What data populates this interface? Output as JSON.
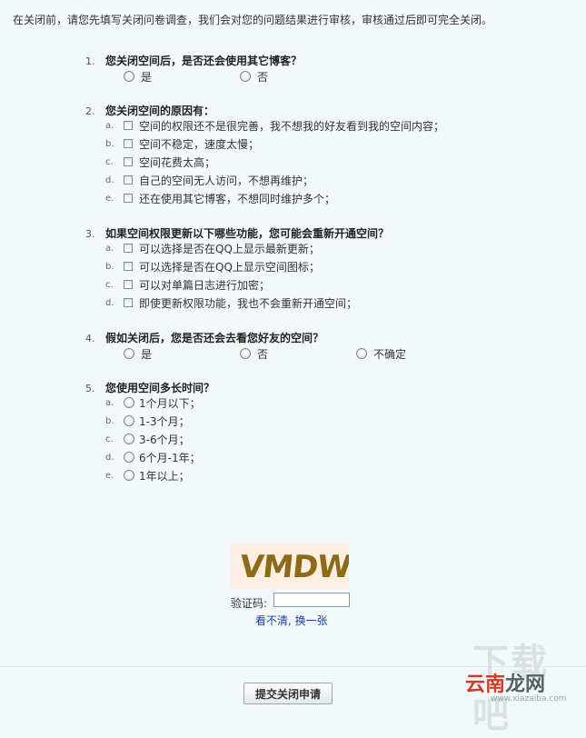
{
  "intro": "在关闭前，请您先填写关闭问卷调查，我们会对您的问题结果进行审核，审核通过后即可完全关闭。",
  "questions": [
    {
      "num": "1.",
      "title": "您关闭空间后，是否还会使用其它博客？",
      "options": [
        "是",
        "否"
      ]
    },
    {
      "num": "2.",
      "title": "您关闭空间的原因有：",
      "options": [
        {
          "letter": "a.",
          "text": "空间的权限还不是很完善，我不想我的好友看到我的空间内容；"
        },
        {
          "letter": "b.",
          "text": "空间不稳定，速度太慢；"
        },
        {
          "letter": "c.",
          "text": "空间花费太高；"
        },
        {
          "letter": "d.",
          "text": "自己的空间无人访问，不想再维护；"
        },
        {
          "letter": "e.",
          "text": "还在使用其它博客，不想同时维护多个；"
        }
      ]
    },
    {
      "num": "3.",
      "title": "如果空间权限更新以下哪些功能，您可能会重新开通空间？",
      "options": [
        {
          "letter": "a.",
          "text": "可以选择是否在QQ上显示最新更新；"
        },
        {
          "letter": "b.",
          "text": "可以选择是否在QQ上显示空间图标；"
        },
        {
          "letter": "c.",
          "text": "可以对单篇日志进行加密；"
        },
        {
          "letter": "d.",
          "text": "即使更新权限功能，我也不会重新开通空间；"
        }
      ]
    },
    {
      "num": "4.",
      "title": "假如关闭后，您是否还会去看您好友的空间？",
      "options": [
        "是",
        "否",
        "不确定"
      ]
    },
    {
      "num": "5.",
      "title": "您使用空间多长时间？",
      "options": [
        {
          "letter": "a.",
          "text": "1个月以下；"
        },
        {
          "letter": "b.",
          "text": "1-3个月；"
        },
        {
          "letter": "c.",
          "text": "3-6个月；"
        },
        {
          "letter": "d.",
          "text": "6个月-1年；"
        },
        {
          "letter": "e.",
          "text": "1年以上；"
        }
      ]
    }
  ],
  "captcha": {
    "image_text": "VMDW",
    "label": "验证码:",
    "input_value": "",
    "refresh_link": "看不清, 换一张"
  },
  "submit_label": "提交关闭申请",
  "watermark": {
    "line1": "下载吧",
    "brand_red": "云南",
    "brand_dark": "龙网",
    "url": "www.xiazaiba.com"
  }
}
